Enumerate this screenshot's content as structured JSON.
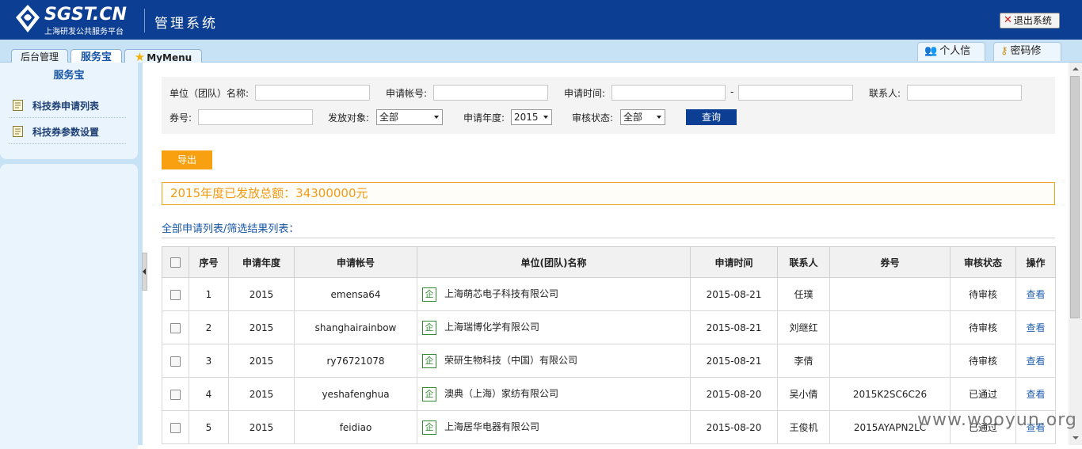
{
  "header": {
    "logo_text": "SGST.CN",
    "logo_sub": "上海研发公共服务平台",
    "title": "管理系统",
    "logout_label": "退出系统"
  },
  "tabs": [
    {
      "label": "后台管理"
    },
    {
      "label": "服务宝"
    },
    {
      "label": "MyMenu"
    }
  ],
  "right_tabs": [
    {
      "label": "个人信"
    },
    {
      "label": "密码修"
    }
  ],
  "sidebar": {
    "title": "服务宝",
    "items": [
      {
        "label": "科技券申请列表"
      },
      {
        "label": "科技券参数设置"
      }
    ]
  },
  "filter": {
    "unit_name_label": "单位（团队）名称:",
    "unit_name_value": "",
    "account_label": "申请帐号:",
    "account_value": "",
    "time_label": "申请时间:",
    "time_from": "",
    "time_sep": "-",
    "time_to": "",
    "contact_label": "联系人:",
    "contact_value": "",
    "voucher_label": "券号:",
    "voucher_value": "",
    "target_label": "发放对象:",
    "target_selected": "全部",
    "year_label": "申请年度:",
    "year_selected": "2015",
    "status_label": "审核状态:",
    "status_selected": "全部",
    "query_label": "查询"
  },
  "export_label": "导出",
  "total_text": "2015年度已发放总额：34300000元",
  "list_title": "全部申请列表/筛选结果列表：",
  "table": {
    "columns": [
      "序号",
      "申请年度",
      "申请帐号",
      "单位(团队)名称",
      "申请时间",
      "联系人",
      "券号",
      "审核状态",
      "操作"
    ],
    "company_badge": "企",
    "action_label": "查看",
    "rows": [
      {
        "no": "1",
        "year": "2015",
        "account": "emensa64",
        "name": "上海萌芯电子科技有限公司",
        "date": "2015-08-21",
        "contact": "任璞",
        "voucher": "",
        "status": "待审核"
      },
      {
        "no": "2",
        "year": "2015",
        "account": "shanghairainbow",
        "name": "上海瑞博化学有限公司",
        "date": "2015-08-21",
        "contact": "刘继红",
        "voucher": "",
        "status": "待审核"
      },
      {
        "no": "3",
        "year": "2015",
        "account": "ry76721078",
        "name": "荣研生物科技（中国）有限公司",
        "date": "2015-08-21",
        "contact": "李倩",
        "voucher": "",
        "status": "待审核"
      },
      {
        "no": "4",
        "year": "2015",
        "account": "yeshafenghua",
        "name": "澳典（上海）家纺有限公司",
        "date": "2015-08-20",
        "contact": "吴小倩",
        "voucher": "2015K2SC6C26",
        "status": "已通过"
      },
      {
        "no": "5",
        "year": "2015",
        "account": "feidiao",
        "name": "上海居华电器有限公司",
        "date": "2015-08-20",
        "contact": "王俊机",
        "voucher": "2015AYAPN2LC",
        "status": "已通过"
      }
    ]
  },
  "watermark": "www.wooyun.org"
}
